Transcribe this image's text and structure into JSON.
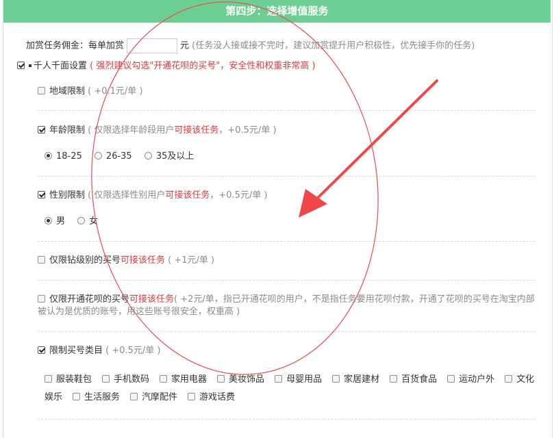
{
  "header": {
    "title": "第四步：选择增值服务"
  },
  "bounty": {
    "label": "加赏任务佣金：每单加赏",
    "input_value": "",
    "unit": "元",
    "note": "(任务没人接或接不完时，建议加赏提升用户积极性，优先接手你的任务)"
  },
  "persona": {
    "label": "千人千面设置",
    "hint": "( 强烈建议勾选\"开通花呗的买号\"，安全性和权重非常高 )"
  },
  "region": {
    "label": "地域限制",
    "price": "( +0.1元/单 )"
  },
  "age": {
    "label": "年龄限制",
    "note_before": "( 仅限选择年龄段用户",
    "note_red": "可接该任务",
    "note_after": "，+0.5元/单 )",
    "options": [
      "18-25",
      "26-35",
      "35及以上"
    ]
  },
  "gender": {
    "label": "性别限制",
    "note_before": "( 仅限选择性别用户",
    "note_red": "可接该任务",
    "note_after": "，+0.5元/单 )",
    "options": [
      "男",
      "女"
    ]
  },
  "diamond": {
    "label_before": "仅限钻级别的买号",
    "label_red": "可接该任务",
    "price": "( +1元/单 )"
  },
  "huabei": {
    "label_before": "仅限开通花呗的买号",
    "label_red": "可接该任务",
    "note_line1": "( +2元/单，指已开通花呗的用户，不是指任务要用花呗付款，开通了花呗的买号在淘宝内部",
    "note_line2": "被认为是优质的账号，用这些账号很安全，权重高 )"
  },
  "category": {
    "label": "限制买号类目",
    "price": "( +0.5元/单 )",
    "items": [
      "服装鞋包",
      "手机数码",
      "家用电器",
      "美妆饰品",
      "母婴用品",
      "家居建材",
      "百货食品",
      "运动户外",
      "文化",
      "娱乐",
      "生活服务",
      "汽摩配件",
      "游戏话费"
    ]
  },
  "colors": {
    "header_bg": "#6cce93",
    "accent_red": "#e4393c",
    "annotation": "#f0484a"
  }
}
